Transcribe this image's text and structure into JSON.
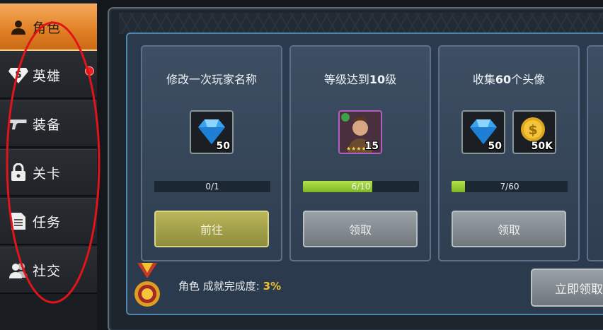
{
  "sidebar": {
    "items": [
      {
        "label": "角色",
        "icon": "person-icon",
        "active": true
      },
      {
        "label": "英雄",
        "icon": "hero-s-icon",
        "notification": true
      },
      {
        "label": "装备",
        "icon": "gun-icon"
      },
      {
        "label": "关卡",
        "icon": "lock-icon"
      },
      {
        "label": "任务",
        "icon": "document-icon"
      },
      {
        "label": "社交",
        "icon": "people-icon"
      }
    ]
  },
  "cards": [
    {
      "title": "修改一次玩家名称",
      "rewards": [
        {
          "icon": "diamond-icon",
          "qty": "50"
        }
      ],
      "progress_text": "0/1",
      "progress": 0.0,
      "button": "前往"
    },
    {
      "title_pre": "等级达到",
      "title_num": "10",
      "title_post": "级",
      "rewards": [
        {
          "icon": "hero-portrait-icon",
          "qty": "15"
        }
      ],
      "progress_text": "6/10",
      "progress": 0.6,
      "button": "领取"
    },
    {
      "title_pre": "收集",
      "title_num": "60",
      "title_post": "个头像",
      "rewards": [
        {
          "icon": "diamond-icon",
          "qty": "50"
        },
        {
          "icon": "gold-coin-icon",
          "qty": "50K"
        }
      ],
      "progress_text": "7/60",
      "progress": 0.1167,
      "button": "领取"
    }
  ],
  "footer": {
    "category": "角色",
    "label": "成就完成度:",
    "percent": "3%",
    "claim_all": "立即领取"
  },
  "colors": {
    "active_tab": "#e8892e",
    "progress_fill": "#9ccd3a",
    "go_button": "#a7a44b",
    "claim_button": "#858d93",
    "annotation": "#e0141a"
  }
}
